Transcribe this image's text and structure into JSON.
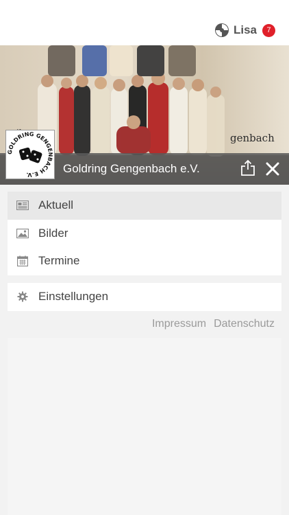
{
  "header": {
    "user_name": "Lisa",
    "notification_count": "7",
    "user_icon": "user-status-icon"
  },
  "hero": {
    "club_name": "Goldring Gengenbach e.V.",
    "sign_text": "genbach",
    "logo_text": "GOLDRING GENGENBACH E.V.",
    "actions": {
      "share_icon": "share-icon",
      "close_icon": "close-icon"
    }
  },
  "menu": {
    "items": [
      {
        "label": "Aktuell",
        "icon": "newspaper-icon",
        "active": true
      },
      {
        "label": "Bilder",
        "icon": "image-icon",
        "active": false
      },
      {
        "label": "Termine",
        "icon": "calendar-icon",
        "active": false
      }
    ],
    "settings": {
      "label": "Einstellungen",
      "icon": "gear-icon"
    }
  },
  "footer_links": {
    "impressum": "Impressum",
    "datenschutz": "Datenschutz"
  },
  "colors": {
    "badge": "#e0202a",
    "active_item": "#e8e8e8",
    "overlay": "#5a5a5a"
  }
}
